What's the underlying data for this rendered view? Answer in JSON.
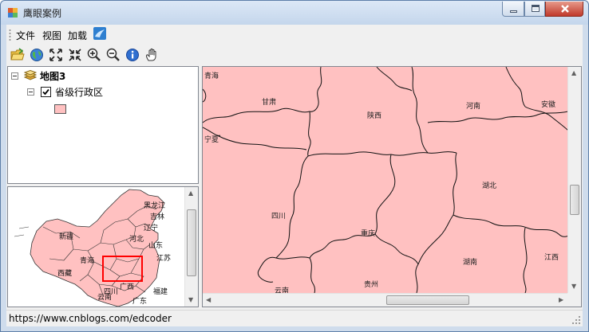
{
  "window": {
    "title": "鹰眼案例"
  },
  "menu": {
    "items": [
      "文件",
      "视图",
      "加载"
    ]
  },
  "toolbar": {
    "buttons": [
      "open-icon",
      "globe-icon",
      "full-extent-icon",
      "fixed-zoom-in-icon",
      "zoom-in-icon",
      "zoom-out-icon",
      "identify-icon",
      "pan-hand-icon"
    ]
  },
  "toc": {
    "map_name": "地图3",
    "layer_name": "省级行政区",
    "layer_checked": true,
    "symbol_color": "#ffc1c1"
  },
  "mapview": {
    "fill_color": "#ffc1c1",
    "labels": [
      "青海",
      "甘肃",
      "陕西",
      "河南",
      "安徽",
      "宁夏",
      "湖北",
      "四川",
      "重庆",
      "湖南",
      "江西",
      "贵州",
      "云南"
    ]
  },
  "overview": {
    "extent_color": "#ff0000",
    "labels": [
      "新疆",
      "青海",
      "西藏",
      "四川",
      "云南",
      "广西",
      "福建",
      "江苏",
      "黑龙江",
      "吉林",
      "辽宁",
      "河北",
      "山东",
      "广东"
    ]
  },
  "status": {
    "text": "https://www.cnblogs.com/edcoder"
  }
}
